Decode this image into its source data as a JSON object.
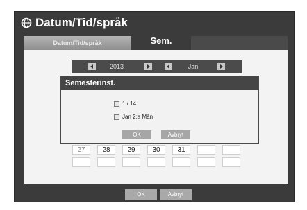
{
  "window": {
    "title": "Datum/Tid/språk"
  },
  "tabs": [
    {
      "label": "Datum/Tid/språk"
    },
    {
      "label": "Sem."
    }
  ],
  "calendar": {
    "year": "2013",
    "month": "Jan",
    "visible_days": [
      "27",
      "28",
      "29",
      "30",
      "31"
    ]
  },
  "dialog": {
    "title": "Semesterinst.",
    "options": [
      {
        "label": "1 / 14",
        "checked": false
      },
      {
        "label": "Jan 2:a Mån",
        "checked": false
      }
    ],
    "ok_label": "OK",
    "cancel_label": "Avbryt"
  },
  "footer": {
    "ok_label": "OK",
    "cancel_label": "Avbryt"
  }
}
